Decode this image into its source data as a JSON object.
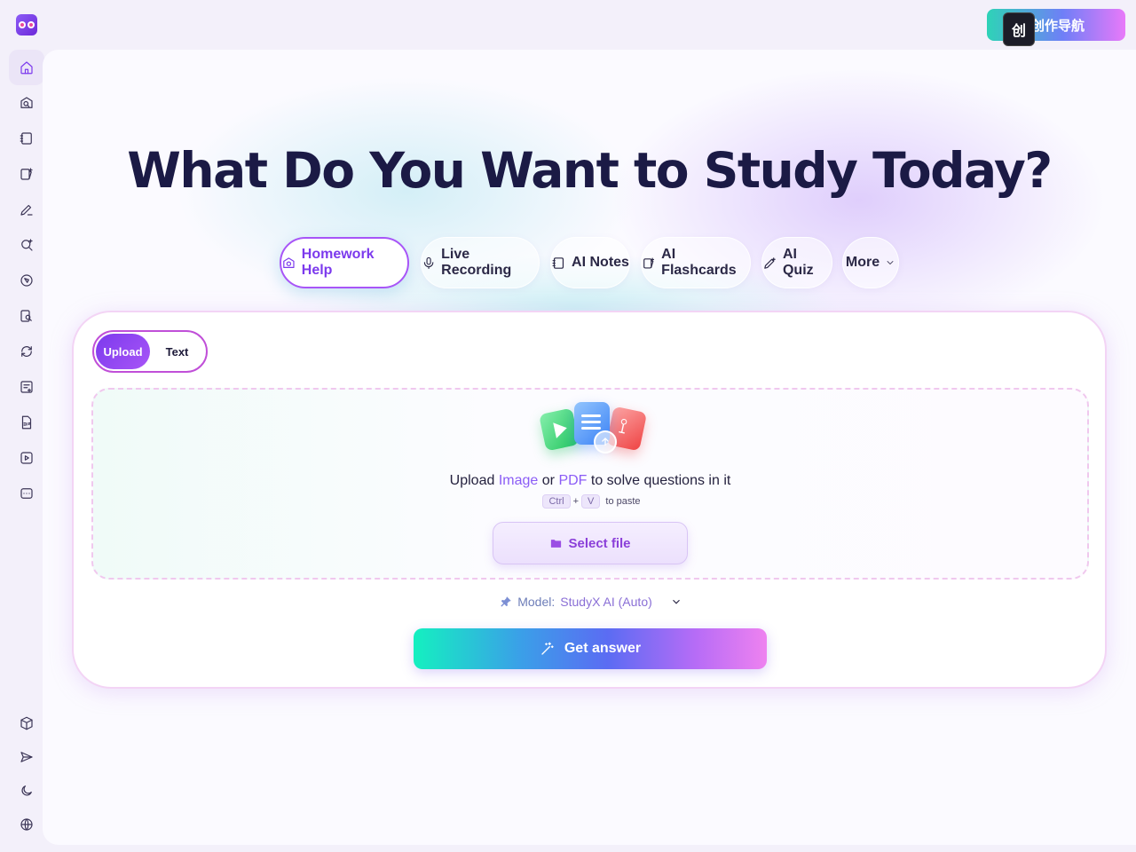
{
  "app": {
    "logo_icon": "owl-logo-icon"
  },
  "top_badge": {
    "chip_text": "创",
    "label": "创作导航"
  },
  "sidebar": {
    "items": [
      {
        "name": "home",
        "icon": "home-icon",
        "active": true
      },
      {
        "name": "homework-help",
        "icon": "camera-search-icon"
      },
      {
        "name": "ai-notes",
        "icon": "notes-icon"
      },
      {
        "name": "ai-flashcards",
        "icon": "flashcards-icon"
      },
      {
        "name": "ai-quiz",
        "icon": "pen-edit-icon"
      },
      {
        "name": "search",
        "icon": "search-sparkle-icon"
      },
      {
        "name": "explore",
        "icon": "compass-icon"
      },
      {
        "name": "pdf-search",
        "icon": "doc-search-icon"
      },
      {
        "name": "refresh",
        "icon": "refresh-icon"
      },
      {
        "name": "note-add",
        "icon": "note-add-icon"
      },
      {
        "name": "pdf",
        "icon": "pdf-icon"
      },
      {
        "name": "video",
        "icon": "video-icon"
      },
      {
        "name": "chat",
        "icon": "chat-icon"
      },
      {
        "name": "extension",
        "icon": "cube-icon"
      },
      {
        "name": "share",
        "icon": "send-icon"
      },
      {
        "name": "theme",
        "icon": "moon-icon"
      },
      {
        "name": "language",
        "icon": "globe-icon"
      }
    ]
  },
  "main": {
    "headline": "What Do You Want to Study Today?",
    "tabs": [
      {
        "label": "Homework Help",
        "icon": "camera-icon",
        "active": true
      },
      {
        "label": "Live Recording",
        "icon": "microphone-icon"
      },
      {
        "label": "AI Notes",
        "icon": "notes-icon"
      },
      {
        "label": "AI Flashcards",
        "icon": "flashcards-icon"
      },
      {
        "label": "AI Quiz",
        "icon": "pen-icon"
      },
      {
        "label": "More",
        "icon": "chevron-down-icon"
      }
    ],
    "card": {
      "mode": {
        "upload": "Upload",
        "text": "Text",
        "selected": "Upload"
      },
      "dropzone": {
        "prefix": "Upload",
        "image_word": "Image",
        "or_word": "or",
        "pdf_word": "PDF",
        "suffix": "to solve questions in it",
        "key1": "Ctrl",
        "plus": "+",
        "key2": "V",
        "paste_hint": "to paste",
        "select_file": "Select file"
      },
      "model": {
        "label": "Model:",
        "value": "StudyX AI (Auto)"
      },
      "submit": "Get answer"
    }
  },
  "colors": {
    "accent": "#7c3aed",
    "tab_active_border": "#a855f7",
    "gradient_start": "#14f0c0",
    "gradient_end": "#ee82f0"
  }
}
